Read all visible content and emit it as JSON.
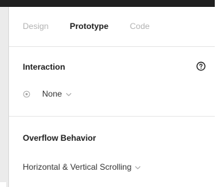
{
  "tabs": [
    {
      "label": "Design",
      "active": false
    },
    {
      "label": "Prototype",
      "active": true
    },
    {
      "label": "Code",
      "active": false
    }
  ],
  "interaction": {
    "title": "Interaction",
    "help_icon": "question-circle-icon",
    "trigger_icon": "target-icon",
    "value": "None"
  },
  "overflow": {
    "title": "Overflow Behavior",
    "value": "Horizontal & Vertical Scrolling"
  },
  "colors": {
    "active_text": "#1e1e1e",
    "inactive_tab": "#b3b3b3",
    "divider": "#e6e6e6",
    "top_bar": "#1f1f1f"
  }
}
